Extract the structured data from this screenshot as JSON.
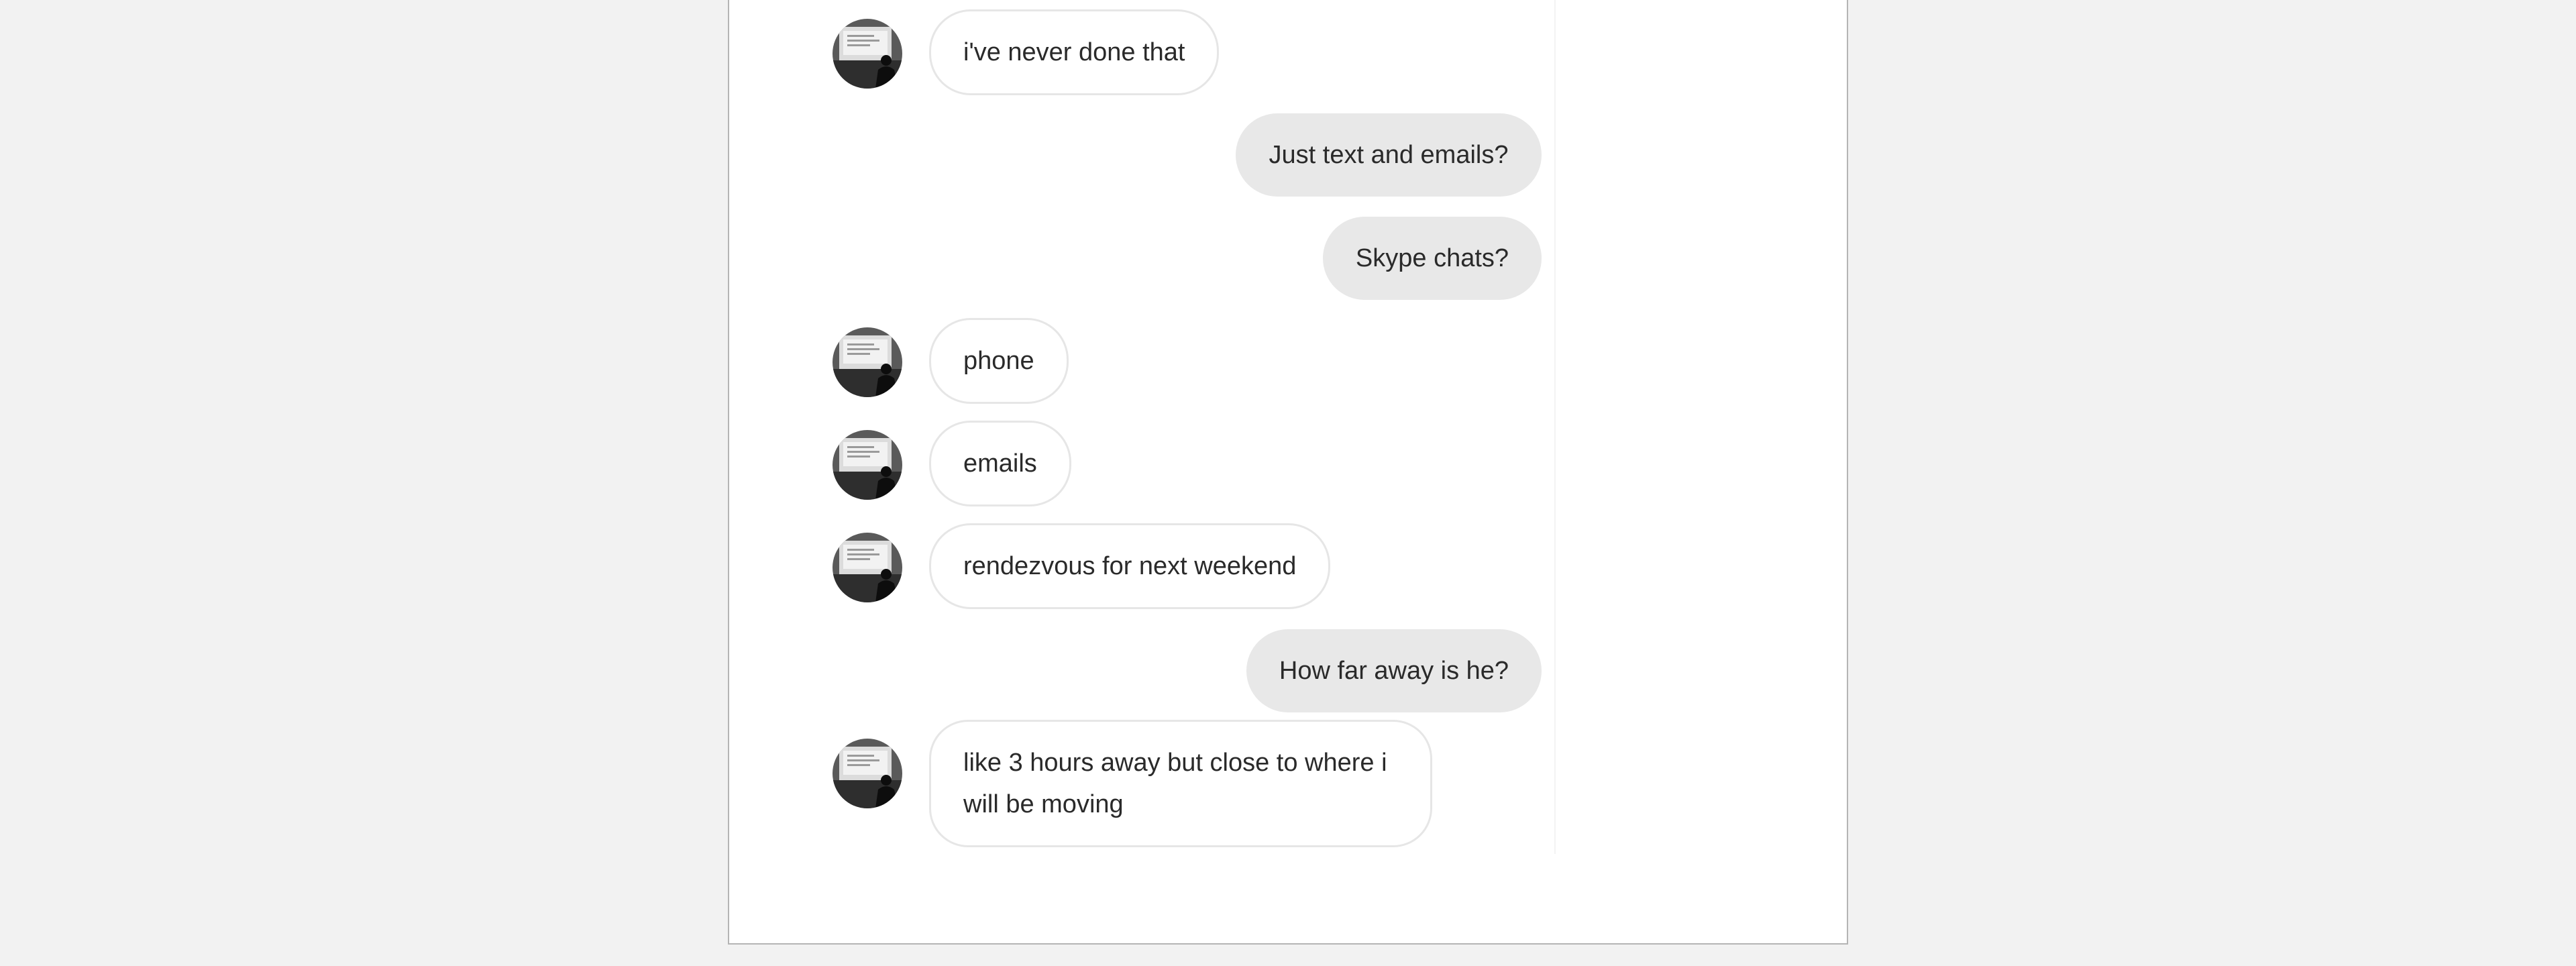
{
  "conversation": {
    "messages": [
      {
        "direction": "incoming",
        "text": "i've never done that"
      },
      {
        "direction": "outgoing",
        "text": "Just text and emails?"
      },
      {
        "direction": "outgoing",
        "text": "Skype chats?"
      },
      {
        "direction": "incoming",
        "text": "phone"
      },
      {
        "direction": "incoming",
        "text": "emails"
      },
      {
        "direction": "incoming",
        "text": "rendezvous for next weekend"
      },
      {
        "direction": "outgoing",
        "text": "How far away is he?"
      },
      {
        "direction": "incoming",
        "text": "like 3 hours away but close to where i will be moving"
      }
    ]
  },
  "theme": {
    "background": "#f2f2f2",
    "page": "#ffffff",
    "incoming_bubble": "#ffffff",
    "incoming_border": "#e6e6e6",
    "outgoing_bubble": "#e8e8e8",
    "text": "#2a2a2a"
  },
  "icons": {
    "avatar": "avatar-photo-icon"
  }
}
